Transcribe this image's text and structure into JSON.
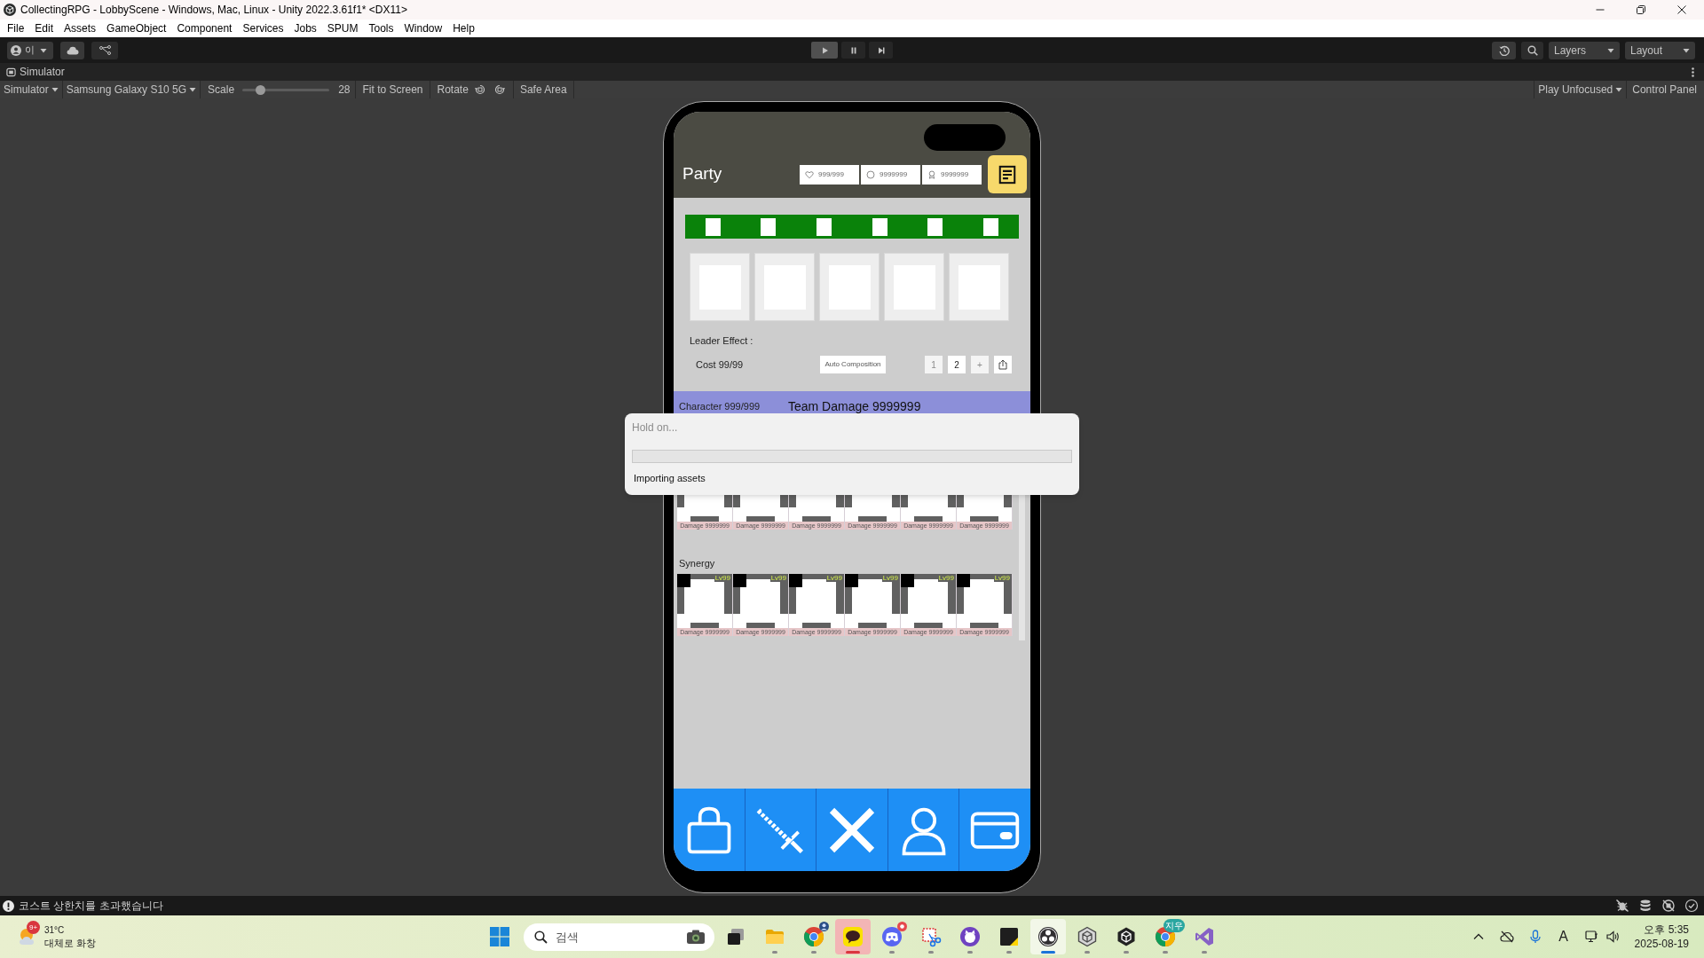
{
  "window": {
    "title": "CollectingRPG - LobbyScene - Windows, Mac, Linux - Unity 2022.3.61f1* <DX11>"
  },
  "menu_bar": [
    "File",
    "Edit",
    "Assets",
    "GameObject",
    "Component",
    "Services",
    "Jobs",
    "SPUM",
    "Tools",
    "Window",
    "Help"
  ],
  "toolbar": {
    "account": "이",
    "play_controls": [
      {
        "kind": "play",
        "highlighted": true
      },
      {
        "kind": "pause",
        "highlighted": false
      },
      {
        "kind": "step",
        "highlighted": false
      }
    ],
    "layers": "Layers",
    "layout": "Layout"
  },
  "simulator": {
    "tab": "Simulator",
    "mode": "Simulator",
    "device": "Samsung Galaxy S10 5G",
    "scale_label": "Scale",
    "scale": {
      "level": 0.2,
      "reading": "28"
    },
    "fit_to_screen": "Fit to Screen",
    "rotate": "Rotate",
    "safe_area": "Safe Area",
    "play_mode": "Play Unfocused",
    "control_panel": "Control Panel"
  },
  "game": {
    "title": "Party",
    "resources": [
      {
        "kind": "heart",
        "value": "999/999"
      },
      {
        "kind": "circle",
        "value": "9999999"
      },
      {
        "kind": "medal",
        "value": "9999999"
      }
    ],
    "leader_effect": "Leader Effect :",
    "cost": "Cost 99/99",
    "auto_composition": "Auto Composition",
    "pages": [
      {
        "label": "1",
        "disabled": true
      },
      {
        "label": "2",
        "disabled": false
      },
      {
        "label": "+",
        "disabled": true
      }
    ],
    "character_count": "Character 999/999",
    "team_damage": "Team Damage 9999999",
    "characters": [
      {
        "damage": "Damage 9999999"
      },
      {
        "damage": "Damage 9999999"
      },
      {
        "damage": "Damage 9999999"
      },
      {
        "damage": "Damage 9999999"
      },
      {
        "damage": "Damage 9999999"
      },
      {
        "damage": "Damage 9999999"
      }
    ],
    "synergy_title": "Synergy",
    "synergies": [
      {
        "level": "Lv99",
        "damage": "Damage 9999999"
      },
      {
        "level": "Lv99",
        "damage": "Damage 9999999"
      },
      {
        "level": "Lv99",
        "damage": "Damage 9999999"
      },
      {
        "level": "Lv99",
        "damage": "Damage 9999999"
      },
      {
        "level": "Lv99",
        "damage": "Damage 9999999"
      },
      {
        "level": "Lv99",
        "damage": "Damage 9999999"
      }
    ],
    "nav": [
      {
        "kind": "bag"
      },
      {
        "kind": "sword"
      },
      {
        "kind": "close"
      },
      {
        "kind": "person"
      },
      {
        "kind": "card"
      }
    ]
  },
  "progress_dialog": {
    "title": "Hold on...",
    "level": 0,
    "message": "Importing assets"
  },
  "console_status": {
    "message": "코스트 상한치를 초과했습니다"
  },
  "taskbar": {
    "weather": {
      "badge": "9+",
      "temperature": "31°C",
      "condition": "대체로 화창"
    },
    "search": {
      "placeholder": "검색"
    },
    "apps": [
      {
        "kind": "task-view",
        "open": false,
        "focused": false,
        "attention": false
      },
      {
        "kind": "folder",
        "open": true,
        "focused": false,
        "attention": false
      },
      {
        "kind": "browser",
        "open": true,
        "focused": false,
        "attention": false,
        "badge": {
          "kind": "avatar"
        }
      },
      {
        "kind": "chat",
        "open": true,
        "focused": false,
        "attention": true
      },
      {
        "kind": "controller",
        "open": true,
        "focused": false,
        "attention": false,
        "badge": {
          "kind": "alert"
        }
      },
      {
        "kind": "snip",
        "open": true,
        "focused": false,
        "attention": false
      },
      {
        "kind": "cat",
        "open": true,
        "focused": false,
        "attention": false
      },
      {
        "kind": "note",
        "open": true,
        "focused": false,
        "attention": false
      },
      {
        "kind": "recorder",
        "open": true,
        "focused": true,
        "attention": false
      },
      {
        "kind": "cube-light",
        "open": true,
        "focused": false,
        "attention": false
      },
      {
        "kind": "cube-dark",
        "open": true,
        "focused": false,
        "attention": false
      },
      {
        "kind": "browser",
        "open": true,
        "focused": false,
        "attention": false,
        "badge": {
          "kind": "text",
          "text": "지우"
        }
      },
      {
        "kind": "ribbon",
        "open": true,
        "focused": false,
        "attention": false
      }
    ],
    "input_method": "A",
    "clock": {
      "time": "오후 5:35",
      "date": "2025-08-19"
    }
  }
}
